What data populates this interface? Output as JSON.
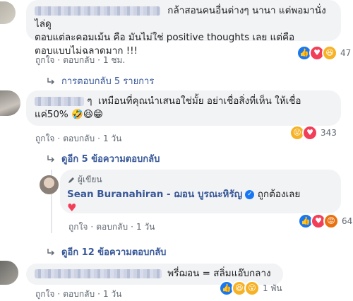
{
  "comments": [
    {
      "line1": "กล้าสอนคนอื่นต่างๆ นานา แต่พอมานั่งไล่ดู",
      "line2": "ตอบแต่ละคอมเม้น คือ มันไม่ใช่ positive thoughts เลย แต่คือ",
      "line3": "ตอบแบบไม่ฉลาดมาก !!!",
      "like": "ถูกใจ",
      "reply": "ตอบกลับ",
      "time": "1 ชม.",
      "reactions": [
        "like-icon",
        "love-icon",
        "haha-icon"
      ],
      "reaction_count": "47",
      "replies_link": "การตอบกลับ 5 รายการ"
    },
    {
      "line1_prefix": "ๆ",
      "line1": "เหมือนที่คุณนำเสนอใช่มั้ย อย่าเชื่อสิ่งที่เห็น ให้เชื่อ",
      "line2": "แค่50%",
      "line2_emoji": "🤣😆😁",
      "like": "ถูกใจ",
      "reply": "ตอบกลับ",
      "time": "1 วัน",
      "reactions": [
        "haha-icon",
        "love-icon"
      ],
      "reaction_count": "343",
      "replies_link": "ดูอีก 5 ข้อความตอบกลับ"
    },
    {
      "author_tag": "ผู้เขียน",
      "author_name": "Sean Buranahiran - ฌอน บูรณะหิรัญ",
      "text": "ถูกต้องเลย",
      "like": "ถูกใจ",
      "reply": "ตอบกลับ",
      "time": "1 วัน",
      "reactions": [
        "like-icon",
        "love-icon",
        "angry-icon"
      ],
      "reaction_count": "64"
    },
    {
      "replies_link": "ดูอีก 12 ข้อความตอบกลับ"
    },
    {
      "text": "พรี่ฌอน = สลิ่มแอ๊บกลาง",
      "like": "ถูกใจ",
      "reply": "ตอบกลับ",
      "time": "1 วัน",
      "reactions": [
        "like-icon",
        "haha-icon",
        "wow-icon"
      ],
      "reaction_count": "1 พัน"
    }
  ],
  "colors": {
    "link": "#385898",
    "bubble": "#f2f3f5",
    "meta": "#606770",
    "like": "#1877f2",
    "love": "#f33e58"
  }
}
